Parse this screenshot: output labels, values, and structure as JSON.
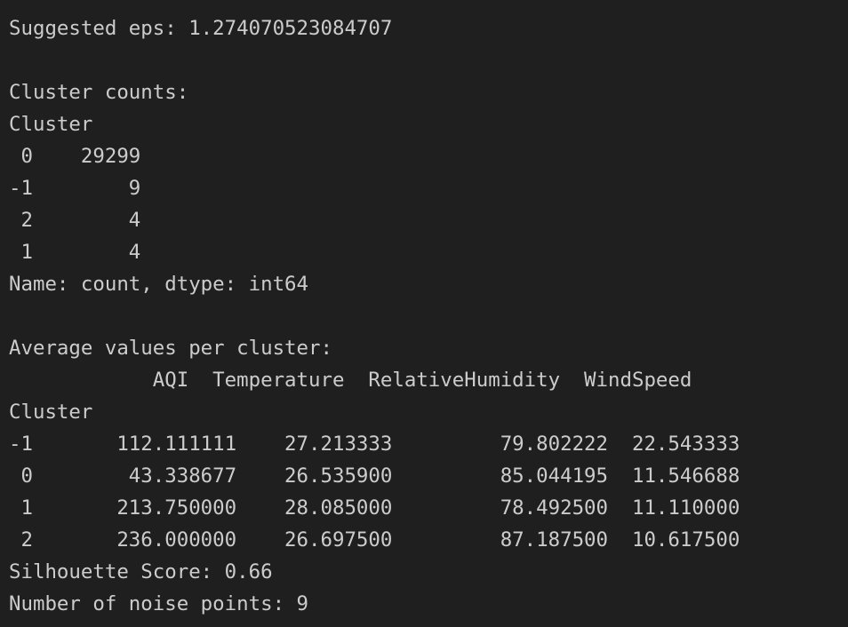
{
  "output": {
    "eps_line": "Suggested eps: 1.274070523084707",
    "counts_title": "Cluster counts:",
    "counts_index_name": "Cluster",
    "counts_rows": [
      " 0    29299",
      "-1        9",
      " 2        4",
      " 1        4"
    ],
    "counts_footer": "Name: count, dtype: int64",
    "avg_title": "Average values per cluster:",
    "avg_header": "            AQI  Temperature  RelativeHumidity  WindSpeed",
    "avg_index_name": "Cluster",
    "avg_rows": [
      "-1       112.111111    27.213333         79.802222  22.543333",
      " 0        43.338677    26.535900         85.044195  11.546688",
      " 1       213.750000    28.085000         78.492500  11.110000",
      " 2       236.000000    26.697500         87.187500  10.617500"
    ],
    "silhouette_line": "Silhouette Score: 0.66",
    "noise_line": "Number of noise points: 9"
  }
}
